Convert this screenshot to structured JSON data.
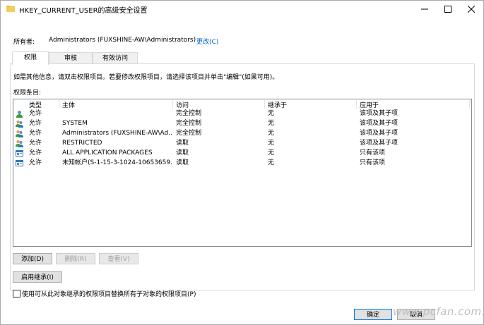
{
  "window": {
    "title": "HKEY_CURRENT_USER的高级安全设置"
  },
  "owner": {
    "label": "所有者:",
    "value": "Administrators (FUXSHINE-AW\\Administrators)",
    "change_link": "更改(C)"
  },
  "tabs": [
    {
      "label": "权限",
      "active": true
    },
    {
      "label": "审核",
      "active": false
    },
    {
      "label": "有效访问",
      "active": false
    }
  ],
  "info_text": "如需其他信息，请双击权限项目。若要修改权限项目，请选择该项目并单击\"编辑\"(如果可用)。",
  "list_label": "权限条目:",
  "columns": [
    "类型",
    "主体",
    "访问",
    "继承于",
    "应用于"
  ],
  "entries": [
    {
      "type": "允许",
      "principal": "",
      "access": "完全控制",
      "inherited": "无",
      "applies": "该项及其子项",
      "icon": "user-icon"
    },
    {
      "type": "允许",
      "principal": "SYSTEM",
      "access": "完全控制",
      "inherited": "无",
      "applies": "该项及其子项",
      "icon": "group-icon"
    },
    {
      "type": "允许",
      "principal": "Administrators (FUXSHINE-AW\\Ad...",
      "access": "完全控制",
      "inherited": "无",
      "applies": "该项及其子项",
      "icon": "group-icon"
    },
    {
      "type": "允许",
      "principal": "RESTRICTED",
      "access": "读取",
      "inherited": "无",
      "applies": "该项及其子项",
      "icon": "group-icon"
    },
    {
      "type": "允许",
      "principal": "ALL APPLICATION PACKAGES",
      "access": "读取",
      "inherited": "无",
      "applies": "只有该项",
      "icon": "package-icon"
    },
    {
      "type": "允许",
      "principal": "未知帐户(S-1-15-3-1024-10653659...",
      "access": "读取",
      "inherited": "无",
      "applies": "只有该项",
      "icon": "package-icon"
    }
  ],
  "buttons": {
    "add": "添加(D)",
    "remove": "删除(R)",
    "view": "查看(V)",
    "enable_inheritance": "启用继承(I)",
    "ok": "确定",
    "cancel": "取消"
  },
  "replace_checkbox": {
    "label": "使用可从此对象继承的权限项目替换所有子对象的权限项目(P)",
    "checked": false
  },
  "watermark": "www.pcfan.com.cn",
  "colors": {
    "link": "#0066cc",
    "ok_border": "#0078d7",
    "folder": "#e8b84a"
  }
}
